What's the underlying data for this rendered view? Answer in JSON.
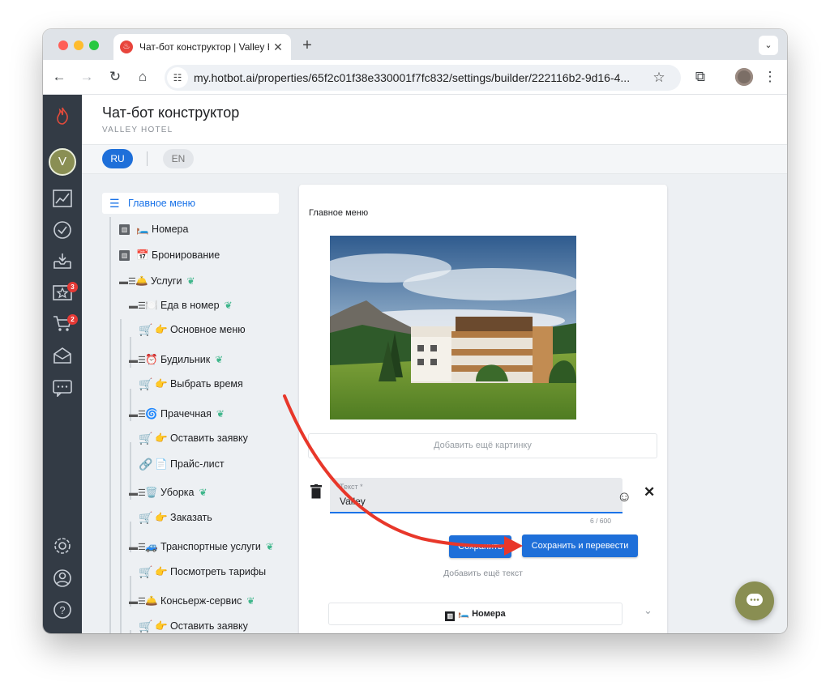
{
  "browser": {
    "tab_title": "Чат-бот конструктор | Valley Hotel",
    "tab_favicon": "hotbot-flame-icon",
    "new_tab": "+",
    "close": "✕",
    "tab_menu": "⌄",
    "url": "my.hotbot.ai/properties/65f2c01f38e330001f7fc832/settings/builder/222116b2-9d16-4..."
  },
  "header": {
    "title": "Чат-бот конструктор",
    "subtitle": "VALLEY HOTEL"
  },
  "languages": {
    "active": "RU",
    "other": "EN"
  },
  "sidebar": {
    "badges": {
      "reviews": "3",
      "orders": "2"
    },
    "avatar_initial": "V"
  },
  "tree": {
    "root": "Главное меню",
    "nodes": [
      {
        "label": "🛏️ Номера"
      },
      {
        "label": "📅 Бронирование"
      },
      {
        "label": "🛎️ Услуги"
      },
      {
        "label": "🍽️ Еда в номер"
      },
      {
        "label": "👉 Основное меню"
      },
      {
        "label": "⏰ Будильник"
      },
      {
        "label": "👉 Выбрать время"
      },
      {
        "label": "🌀 Прачечная"
      },
      {
        "label": "👉 Оставить заявку"
      },
      {
        "label": "📄 Прайс-лист"
      },
      {
        "label": "🗑️ Уборка"
      },
      {
        "label": "👉 Заказать"
      },
      {
        "label": "🚙 Транспортные услуги"
      },
      {
        "label": "👉 Посмотреть тарифы"
      },
      {
        "label": "🛎️ Консьерж-сервис"
      },
      {
        "label": "👉 Оставить заявку"
      }
    ]
  },
  "editor": {
    "card_title": "Главное меню",
    "add_image": "Добавить ещё картинку",
    "text_label": "Текст *",
    "text_value": "Valley",
    "counter": "6 / 600",
    "save": "Сохранить",
    "save_translate": "Сохранить и перевести",
    "add_text": "Добавить ещё текст",
    "next_node": "🛏️ Номера"
  },
  "colors": {
    "primary": "#1e6fd9",
    "sidebar": "#333b45",
    "annotation_arrow": "#e8372a",
    "chat_fab": "#898e52"
  }
}
